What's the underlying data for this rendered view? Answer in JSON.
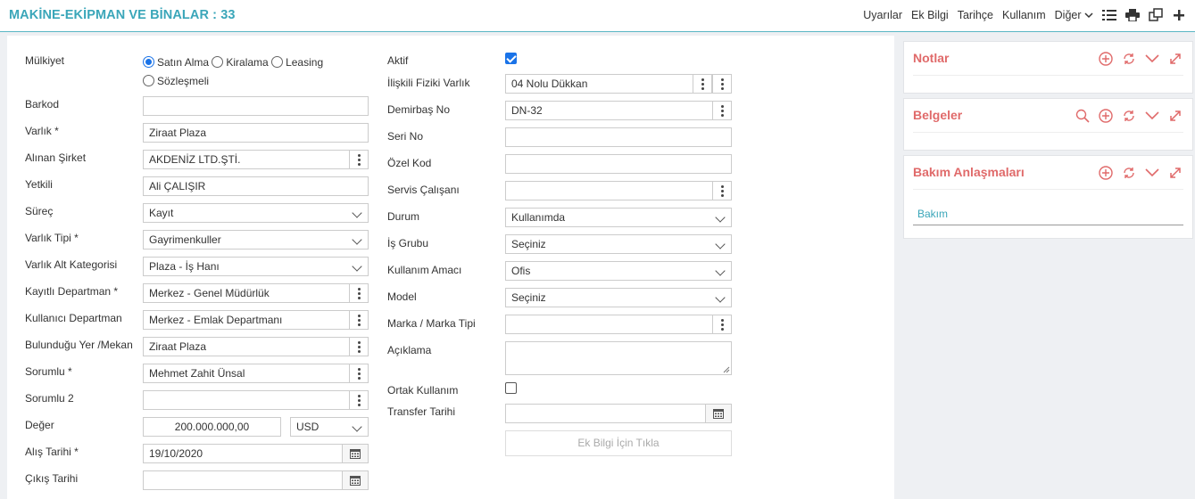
{
  "header": {
    "title": "MAKİNE-EKİPMAN VE BİNALAR : 33",
    "nav": [
      "Uyarılar",
      "Ek Bilgi",
      "Tarihçe",
      "Kullanım",
      "Diğer"
    ]
  },
  "left": {
    "mulkiyet_label": "Mülkiyet",
    "mulkiyet_options": [
      "Satın Alma",
      "Kiralama",
      "Leasing",
      "Sözleşmeli"
    ],
    "mulkiyet_selected": "Satın Alma",
    "barkod_label": "Barkod",
    "barkod_value": "",
    "varlik_label": "Varlık *",
    "varlik_value": "Ziraat Plaza",
    "alinan_sirket_label": "Alınan Şirket",
    "alinan_sirket_value": "AKDENİZ LTD.ŞTİ.",
    "yetkili_label": "Yetkili",
    "yetkili_value": "Ali ÇALIŞIR",
    "surec_label": "Süreç",
    "surec_value": "Kayıt",
    "varlik_tipi_label": "Varlık Tipi *",
    "varlik_tipi_value": "Gayrimenkuller",
    "alt_kategori_label": "Varlık Alt Kategorisi",
    "alt_kategori_value": "Plaza - İş Hanı",
    "kayitli_departman_label": "Kayıtlı Departman *",
    "kayitli_departman_value": "Merkez - Genel Müdürlük",
    "kullanici_departman_label": "Kullanıcı Departman",
    "kullanici_departman_value": "Merkez - Emlak Departmanı",
    "bulundugu_yer_label": "Bulunduğu Yer /Mekan",
    "bulundugu_yer_value": "Ziraat Plaza",
    "sorumlu_label": "Sorumlu *",
    "sorumlu_value": "Mehmet Zahit Ünsal",
    "sorumlu2_label": "Sorumlu 2",
    "sorumlu2_value": "",
    "deger_label": "Değer",
    "deger_value": "200.000.000,00",
    "para_birimi": "USD",
    "alis_tarihi_label": "Alış Tarihi *",
    "alis_tarihi_value": "19/10/2020",
    "cikis_tarihi_label": "Çıkış Tarihi",
    "cikis_tarihi_value": ""
  },
  "right": {
    "aktif_label": "Aktif",
    "aktif_checked": true,
    "iliskili_label": "İlişkili Fiziki Varlık",
    "iliskili_value": "04 Nolu Dükkan",
    "demirbas_label": "Demirbaş No",
    "demirbas_value": "DN-32",
    "seri_label": "Seri No",
    "seri_value": "",
    "ozel_kod_label": "Özel Kod",
    "ozel_kod_value": "",
    "servis_label": "Servis Çalışanı",
    "servis_value": "",
    "durum_label": "Durum",
    "durum_value": "Kullanımda",
    "is_grubu_label": "İş Grubu",
    "is_grubu_value": "Seçiniz",
    "kullanim_amaci_label": "Kullanım Amacı",
    "kullanim_amaci_value": "Ofis",
    "model_label": "Model",
    "model_value": "Seçiniz",
    "marka_label": "Marka / Marka Tipi",
    "marka_value": "",
    "aciklama_label": "Açıklama",
    "aciklama_value": "",
    "ortak_label": "Ortak Kullanım",
    "ortak_checked": false,
    "transfer_label": "Transfer Tarihi",
    "transfer_value": "",
    "ek_bilgi_button": "Ek Bilgi İçin Tıkla"
  },
  "panels": {
    "notlar": "Notlar",
    "belgeler": "Belgeler",
    "bakim": "Bakım Anlaşmaları",
    "bakim_item": "Bakım"
  },
  "colors": {
    "accent": "#3aa6b9",
    "panel_title": "#e06a6a",
    "checkbox": "#1a73e8"
  }
}
